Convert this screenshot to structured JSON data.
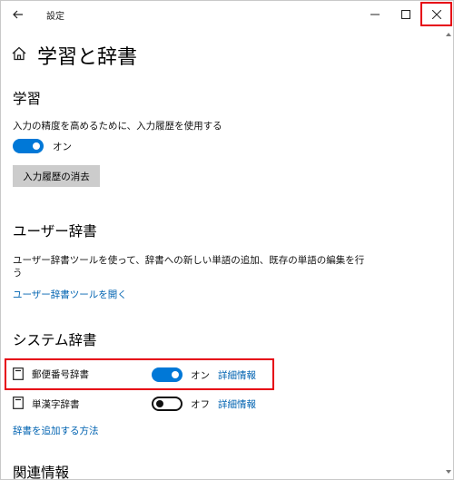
{
  "window": {
    "title": "設定"
  },
  "page": {
    "title": "学習と辞書"
  },
  "learning": {
    "heading": "学習",
    "description": "入力の精度を高めるために、入力履歴を使用する",
    "toggle_state": "オン",
    "toggle_on": true,
    "clear_button": "入力履歴の消去"
  },
  "user_dictionary": {
    "heading": "ユーザー辞書",
    "description_line1": "ユーザー辞書ツールを使って、辞書への新しい単語の追加、既存の単語の編集を行",
    "description_line2": "う",
    "link": "ユーザー辞書ツールを開く"
  },
  "system_dictionary": {
    "heading": "システム辞書",
    "items": [
      {
        "name": "郵便番号辞書",
        "state": "オン",
        "on": true,
        "link": "詳細情報"
      },
      {
        "name": "単漢字辞書",
        "state": "オフ",
        "on": false,
        "link": "詳細情報"
      }
    ],
    "add_link": "辞書を追加する方法"
  },
  "related": {
    "heading": "関連情報"
  },
  "icons": {
    "back": "back-arrow-icon",
    "home": "home-icon",
    "minimize": "minimize-icon",
    "maximize": "maximize-icon",
    "close": "close-icon",
    "dictionary": "book-icon"
  },
  "colors": {
    "accent": "#0078d7",
    "link": "#0063b1",
    "highlight": "#e60012"
  }
}
